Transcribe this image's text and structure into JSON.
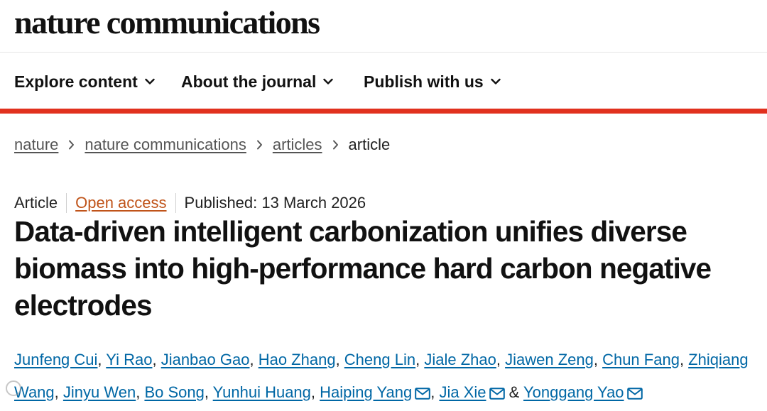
{
  "header": {
    "logo_text": "nature communications"
  },
  "nav": {
    "items": [
      {
        "label": "Explore content"
      },
      {
        "label": "About the journal"
      },
      {
        "label": "Publish with us"
      }
    ],
    "accent_color": "#e1311e"
  },
  "breadcrumb": {
    "items": [
      "nature",
      "nature communications",
      "articles"
    ],
    "current": "article"
  },
  "article": {
    "type": "Article",
    "access": "Open access",
    "published": "Published: 13 March 2026",
    "title": "Data-driven intelligent carbonization unifies diverse biomass into high-performance hard carbon negative electrodes",
    "authors": [
      "Junfeng Cui",
      "Yi Rao",
      "Jianbao Gao",
      "Hao Zhang",
      "Cheng Lin",
      "Jiale Zhao",
      "Jiawen Zeng",
      "Chun Fang",
      "Zhiqiang Wang",
      "Jinyu Wen",
      "Bo Song",
      "Yunhui Huang",
      "Haiping Yang",
      "Jia Xie",
      "Yonggang Yao"
    ],
    "sep": ", ",
    "amp": " & "
  },
  "colors": {
    "link_blue": "#0067a5",
    "open_access_orange": "#c0541a",
    "nav_rule_red": "#e1311e"
  },
  "icons": {
    "nav_dropdown": "chevron-down-icon",
    "breadcrumb_separator": "chevron-right-icon",
    "corresponding_author": "mail-icon"
  }
}
